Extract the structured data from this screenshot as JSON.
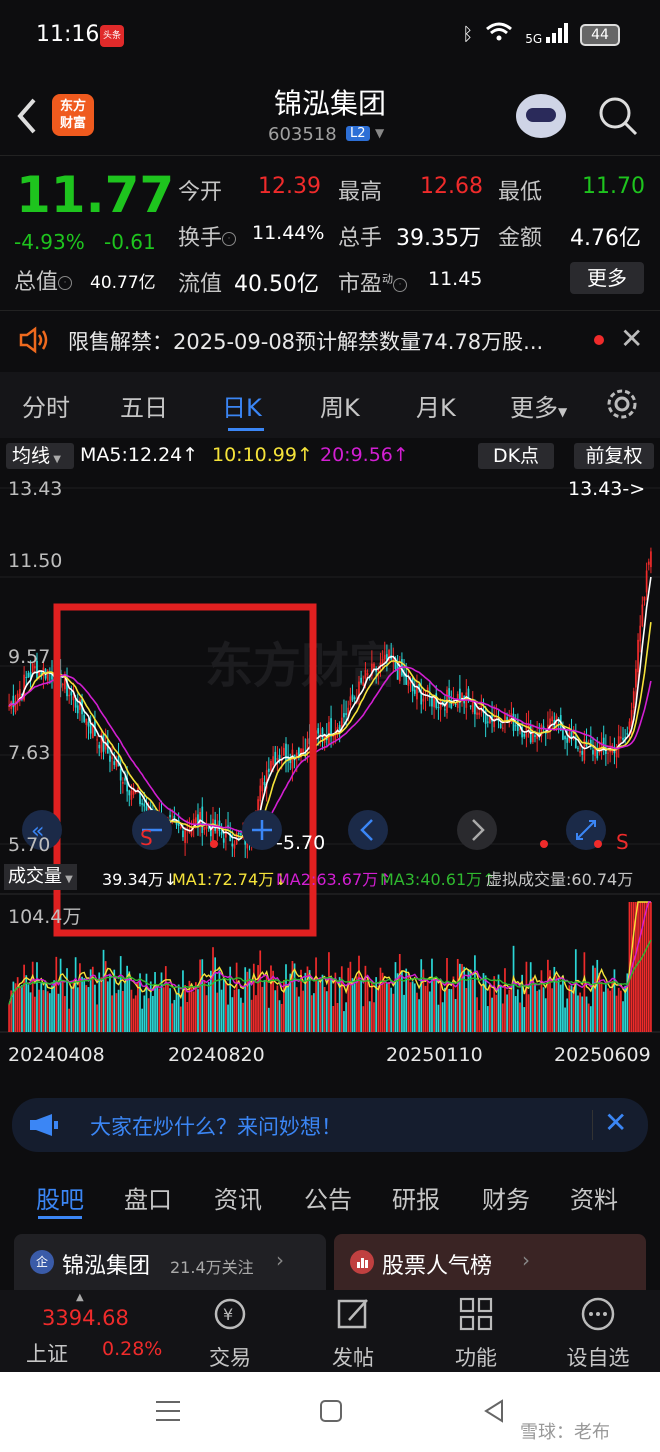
{
  "status_bar": {
    "time": "11:16",
    "toutiao_badge": "头条",
    "network": "5G",
    "battery": "44"
  },
  "header": {
    "app_logo": "东方\n财富",
    "stock_name": "锦泓集团",
    "stock_code": "603518",
    "level_badge": "L2"
  },
  "quote": {
    "price": "11.77",
    "change_pct": "-4.93%",
    "change_abs": "-0.61",
    "market_cap_label": "总值",
    "market_cap": "40.77亿",
    "open_label": "今开",
    "open": "12.39",
    "high_label": "最高",
    "high": "12.68",
    "low_label": "最低",
    "low": "11.70",
    "turnover_rate_label": "换手",
    "turnover_rate": "11.44%",
    "volume_label": "总手",
    "volume": "39.35万",
    "amount_label": "金额",
    "amount": "4.76亿",
    "float_cap_label": "流值",
    "float_cap": "40.50亿",
    "pe_label": "市盈",
    "pe_sup": "动",
    "pe": "11.45",
    "more_label": "更多"
  },
  "notice": {
    "text": "限售解禁：2025-09-08预计解禁数量74.78万股..."
  },
  "period_tabs": [
    "分时",
    "五日",
    "日K",
    "周K",
    "月K",
    "更多"
  ],
  "active_tab": "日K",
  "ma_bar": {
    "type_label": "均线",
    "ma5": "MA5:12.24↑",
    "ma10": "10:10.99↑",
    "ma20": "20:9.56↑",
    "dk_label": "DK点",
    "fq_label": "前复权"
  },
  "colors": {
    "up": "#ef2b2b",
    "down": "#1ec41e",
    "ma5": "#ffffff",
    "ma10": "#f5e33a",
    "ma20": "#d21fd2",
    "accent": "#3b86f5",
    "vol_ma3": "#2fb82f",
    "cyan_bar": "#2ad6d6"
  },
  "chart_data": {
    "type": "candlestick",
    "price_ticks": [
      "13.43",
      "11.50",
      "9.57",
      "7.63",
      "5.70"
    ],
    "last_label": "13.43->",
    "low_label": "-5.70",
    "date_ticks": [
      "20240408",
      "20240820",
      "20250110",
      "20250609"
    ],
    "close_trend": [
      8.7,
      9.5,
      9.4,
      8.6,
      7.8,
      7.0,
      6.3,
      6.0,
      6.2,
      5.9,
      5.8,
      7.6,
      7.7,
      8.0,
      8.4,
      9.3,
      9.7,
      9.0,
      8.8,
      8.9,
      8.5,
      8.4,
      8.1,
      8.3,
      7.8,
      7.7,
      8.0,
      12.24
    ],
    "volume": {
      "label": "成交量",
      "current": "39.34万↓",
      "ma1": "MA1:72.74万↓",
      "ma2": "MA2:63.67万↑",
      "ma3": "MA3:40.61万↑",
      "virtual": "虚拟成交量:60.74万",
      "max_tick": "104.4万"
    },
    "markers": {
      "sell": "S"
    }
  },
  "banner": {
    "text": "大家在炒什么？来问妙想！"
  },
  "sub_tabs": [
    "股吧",
    "盘口",
    "资讯",
    "公告",
    "研报",
    "财务",
    "资料"
  ],
  "cards": [
    {
      "icon_text": "企",
      "title": "锦泓集团",
      "sub": "21.4万关注"
    },
    {
      "icon_text": "",
      "title": "股票人气榜",
      "sub": ""
    }
  ],
  "index": {
    "value": "3394.68",
    "name": "上证",
    "pct": "0.28%"
  },
  "bottom_nav": [
    "交易",
    "发帖",
    "功能",
    "设自选"
  ],
  "watermark": "雪球：老布"
}
